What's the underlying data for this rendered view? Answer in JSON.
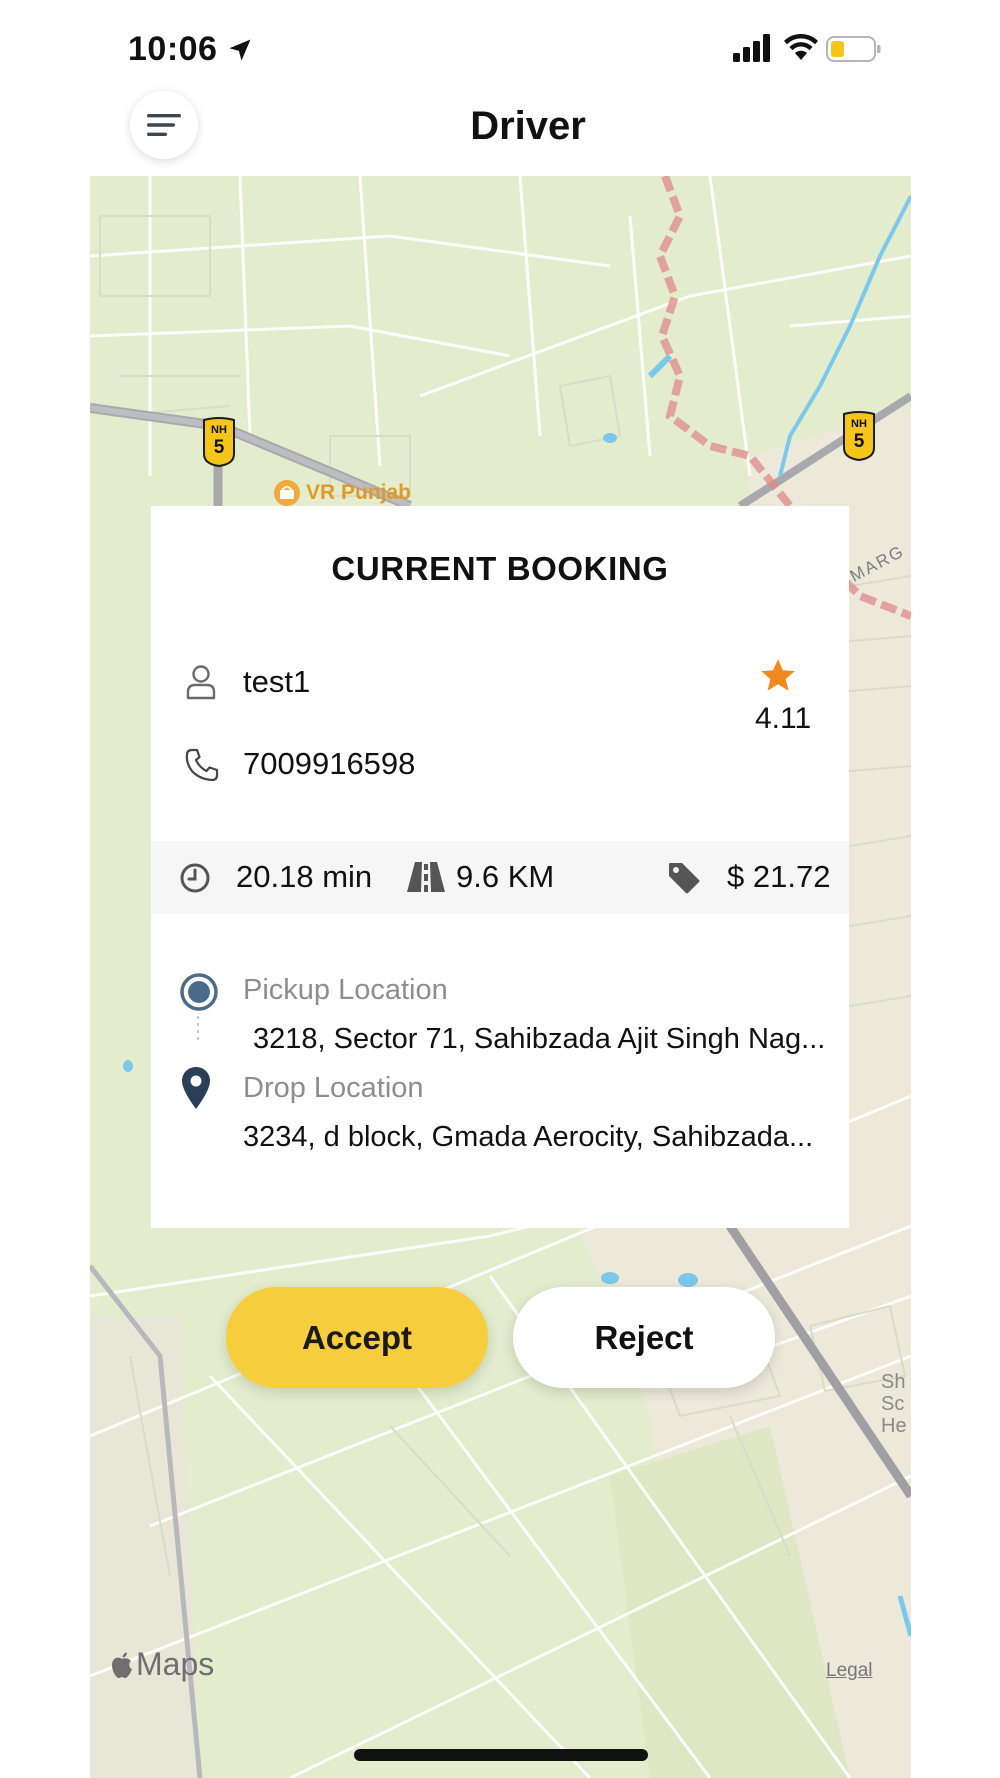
{
  "status_bar": {
    "time": "10:06"
  },
  "header": {
    "title": "Driver"
  },
  "map": {
    "poi_label": "VR Punjab",
    "highway_shield_line1": "NH",
    "highway_shield_line2": "5",
    "road_label": "MARG",
    "right_labels": [
      "Sh",
      "Sc",
      "He"
    ],
    "provider": "Maps",
    "legal_label": "Legal"
  },
  "booking": {
    "title": "CURRENT BOOKING",
    "customer_name": "test1",
    "phone": "7009916598",
    "rating": "4.11",
    "duration": "20.18 min",
    "distance": "9.6 KM",
    "fare": "$ 21.72",
    "pickup_label": "Pickup Location",
    "pickup_address": "3218, Sector 71, Sahibzada Ajit Singh Nag...",
    "drop_label": "Drop Location",
    "drop_address": "3234, d block, Gmada Aerocity, Sahibzada..."
  },
  "actions": {
    "accept_label": "Accept",
    "reject_label": "Reject"
  },
  "colors": {
    "accent": "#f6cd3c",
    "star": "#f08a1c",
    "pickup_icon": "#4a6c8a",
    "drop_icon": "#2c3e58",
    "map_background": "#e3eccd"
  },
  "icons": {
    "menu": "hamburger-icon",
    "location_arrow": "location-arrow-icon",
    "user": "user-icon",
    "phone": "phone-icon",
    "star": "star-icon",
    "clock": "clock-icon",
    "road": "road-icon",
    "tag": "tag-icon",
    "pickup": "pickup-dot-icon",
    "drop": "map-pin-icon"
  }
}
